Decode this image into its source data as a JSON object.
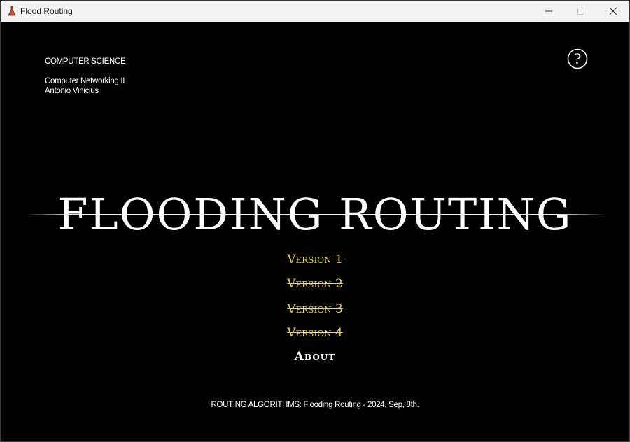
{
  "window": {
    "title": "Flood Routing",
    "icon": "app-flask-icon"
  },
  "window_controls": [
    "minimize-icon",
    "maximize-icon",
    "close-icon"
  ],
  "course": {
    "department": "COMPUTER SCIENCE",
    "subject": "Computer Networking II",
    "author": "Antonio Vinicius"
  },
  "help": {
    "icon": "help-circle-icon",
    "glyph": "?"
  },
  "hero": {
    "title": "FLOODING ROUTING"
  },
  "menu": {
    "items": [
      {
        "label": "Version 1"
      },
      {
        "label": "Version 2"
      },
      {
        "label": "Version 3"
      },
      {
        "label": "Version 4"
      },
      {
        "label": "About"
      }
    ]
  },
  "footer": {
    "text": "ROUTING ALGORITHMS: Flooding Routing - 2024, Sep, 8th."
  },
  "colors": {
    "background": "#000000",
    "text": "#ffffff",
    "version_accent": "#e8cc3e"
  }
}
